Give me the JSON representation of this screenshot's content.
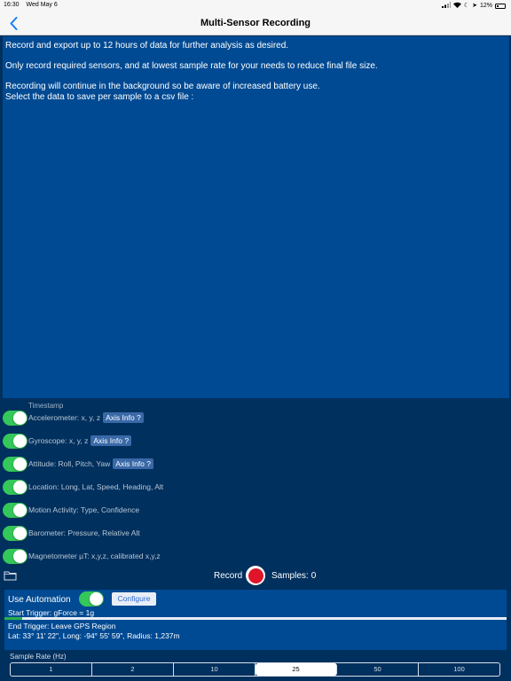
{
  "status_bar": {
    "time": "16:30",
    "date": "Wed May 6",
    "battery": "12%"
  },
  "nav": {
    "title": "Multi-Sensor Recording",
    "back_icon": "chevron-left-icon"
  },
  "info": {
    "line1": "Record and export up to 12 hours of data for further analysis as desired.",
    "line2": "Only record required sensors, and at lowest sample rate for your needs to reduce final file size.",
    "line3": "Recording will continue in the background so be aware of increased battery use.",
    "line4": "Select the data to save per sample to a csv file :"
  },
  "sensors": {
    "timestamp_label": "Timestamp",
    "axis_info_label": "Axis Info ?",
    "accelerometer": "Accelerometer: x, y, z",
    "gyroscope": "Gyroscope: x, y, z",
    "attitude": "Attitude: Roll, Pitch, Yaw",
    "location": "Location: Long, Lat, Speed, Heading, Alt",
    "motion": "Motion Activity: Type, Confidence",
    "barometer": "Barometer: Pressure, Relative Alt",
    "magnetometer": "Magnetometer µT: x,y,z, calibrated x,y,z"
  },
  "record": {
    "label": "Record",
    "samples_label": "Samples:",
    "samples_value": "0"
  },
  "automation": {
    "label": "Use Automation",
    "configure_label": "Configure",
    "start_trigger": "Start Trigger: gForce = 1g",
    "progress": 0.035,
    "end_trigger": "End Trigger: Leave GPS Region",
    "location": "Lat:  33° 11' 22\", Long: -94° 55' 59\", Radius: 1,237m"
  },
  "sample_rate": {
    "label": "Sample Rate (Hz)",
    "options": [
      "1",
      "2",
      "10",
      "25",
      "50",
      "100"
    ],
    "selected": "25"
  },
  "colors": {
    "background": "#00305e",
    "panel": "#004a93",
    "toggle_on": "#34c759",
    "record": "#e0152a"
  }
}
